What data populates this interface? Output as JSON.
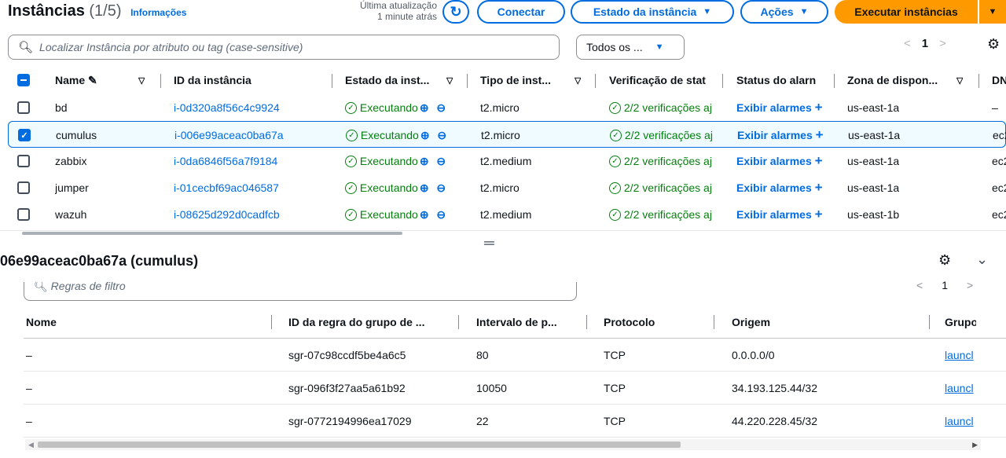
{
  "header": {
    "title": "Instâncias",
    "count": "(1/5)",
    "info_link": "Informações",
    "last_update_label": "Última atualização",
    "last_update_value": "1 minute atrás",
    "refresh_icon": "refresh-icon",
    "connect": "Conectar",
    "instance_state": "Estado da instância",
    "actions": "Ações",
    "launch": "Executar instâncias"
  },
  "search": {
    "placeholder": "Localizar Instância por atributo ou tag (case-sensitive)",
    "filter_value": "Todos os ...",
    "page": "1"
  },
  "columns": {
    "name": "Name",
    "id": "ID da instância",
    "state": "Estado da inst...",
    "type": "Tipo de inst...",
    "check": "Verificação de stat",
    "alarm": "Status do alarn",
    "zone": "Zona de dispon...",
    "dns": "DN"
  },
  "instances": [
    {
      "name": "bd",
      "id": "i-0d320a8f56c4c9924",
      "state": "Executando",
      "type": "t2.micro",
      "check": "2/2 verificações aj",
      "alarm": "Exibir alarmes",
      "zone": "us-east-1a",
      "dns": "–",
      "selected": false
    },
    {
      "name": "cumulus",
      "id": "i-006e99aceac0ba67a",
      "state": "Executando",
      "type": "t2.micro",
      "check": "2/2 verificações aj",
      "alarm": "Exibir alarmes",
      "zone": "us-east-1a",
      "dns": "ec2",
      "selected": true
    },
    {
      "name": "zabbix",
      "id": "i-0da6846f56a7f9184",
      "state": "Executando",
      "type": "t2.medium",
      "check": "2/2 verificações aj",
      "alarm": "Exibir alarmes",
      "zone": "us-east-1a",
      "dns": "ec2",
      "selected": false
    },
    {
      "name": "jumper",
      "id": "i-01cecbf69ac046587",
      "state": "Executando",
      "type": "t2.micro",
      "check": "2/2 verificações aj",
      "alarm": "Exibir alarmes",
      "zone": "us-east-1a",
      "dns": "ec2",
      "selected": false
    },
    {
      "name": "wazuh",
      "id": "i-08625d292d0cadfcb",
      "state": "Executando",
      "type": "t2.medium",
      "check": "2/2 verificações aj",
      "alarm": "Exibir alarmes",
      "zone": "us-east-1b",
      "dns": "ec2",
      "selected": false
    }
  ],
  "detail": {
    "title": "06e99aceac0ba67a (cumulus)",
    "rule_search_placeholder": "Regras de filtro",
    "columns": {
      "name": "Nome",
      "rule_id": "ID da regra do grupo de ...",
      "range": "Intervalo de p...",
      "protocol": "Protocolo",
      "origin": "Origem",
      "group": "Grupo"
    },
    "rules": [
      {
        "name": "–",
        "rule_id": "sgr-07c98ccdf5be4a6c5",
        "range": "80",
        "protocol": "TCP",
        "origin": "0.0.0.0/0",
        "group": "launcl"
      },
      {
        "name": "–",
        "rule_id": "sgr-096f3f27aa5a61b92",
        "range": "10050",
        "protocol": "TCP",
        "origin": "34.193.125.44/32",
        "group": "launcl"
      },
      {
        "name": "–",
        "rule_id": "sgr-0772194996ea17029",
        "range": "22",
        "protocol": "TCP",
        "origin": "44.220.228.45/32",
        "group": "launcl"
      }
    ]
  },
  "colors": {
    "accent": "#006ce0",
    "primary": "#ff9900",
    "success": "#037f0c"
  }
}
